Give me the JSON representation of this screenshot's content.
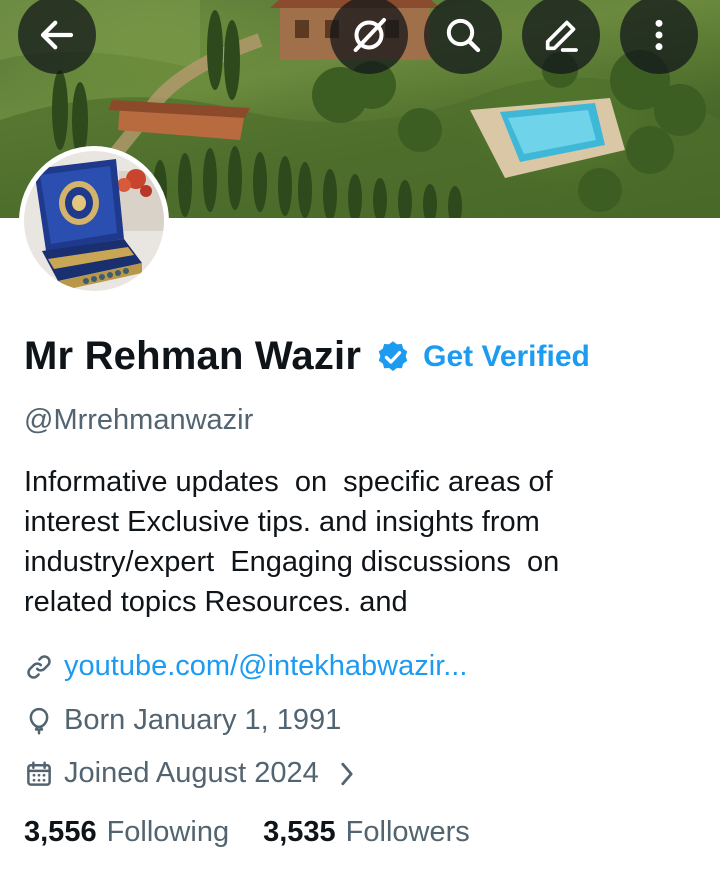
{
  "header": {
    "icons": {
      "back": "arrow-left-icon",
      "grok": "grok-icon",
      "search": "search-icon",
      "edit": "pencil-icon",
      "more": "more-vertical-icon"
    }
  },
  "profile": {
    "display_name": "Mr Rehman Wazir",
    "get_verified_label": "Get Verified",
    "handle": "@Mrrehmanwazir",
    "bio": "Informative updates  on  specific areas of\ninterest Exclusive tips. and insights from\nindustry/expert  Engaging discussions  on\nrelated topics Resources. and",
    "website": "youtube.com/@intekhabwazir...",
    "birthday": "Born January 1, 1991",
    "joined": "Joined August 2024"
  },
  "stats": {
    "following_count": "3,556",
    "following_label": "Following",
    "followers_count": "3,535",
    "followers_label": "Followers"
  },
  "colors": {
    "accent": "#1d9bf0",
    "text_primary": "#0f1419",
    "text_secondary": "#536471"
  }
}
